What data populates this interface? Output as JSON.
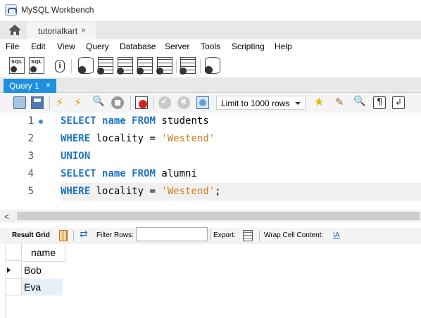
{
  "window": {
    "title": "MySQL Workbench"
  },
  "connection_tab": {
    "label": "tutorialkart",
    "close": "×"
  },
  "menu": [
    "File",
    "Edit",
    "View",
    "Query",
    "Database",
    "Server",
    "Tools",
    "Scripting",
    "Help"
  ],
  "query_tab": {
    "label": "Query 1",
    "close": "×"
  },
  "sql_toolbar": {
    "limit_value": "Limit to 1000 rows"
  },
  "editor": {
    "line_numbers": [
      "1",
      "2",
      "3",
      "4",
      "5"
    ],
    "lines": [
      [
        {
          "t": "SELECT",
          "k": "kw"
        },
        {
          "t": " "
        },
        {
          "t": "name",
          "k": "kw"
        },
        {
          "t": " "
        },
        {
          "t": "FROM",
          "k": "kw"
        },
        {
          "t": " students"
        }
      ],
      [
        {
          "t": "WHERE",
          "k": "kw"
        },
        {
          "t": " locality = "
        },
        {
          "t": "'Westend'",
          "k": "str"
        }
      ],
      [
        {
          "t": "UNION",
          "k": "kw"
        }
      ],
      [
        {
          "t": "SELECT",
          "k": "kw"
        },
        {
          "t": " "
        },
        {
          "t": "name",
          "k": "kw"
        },
        {
          "t": " "
        },
        {
          "t": "FROM",
          "k": "kw"
        },
        {
          "t": " alumni"
        }
      ],
      [
        {
          "t": "WHERE",
          "k": "kw"
        },
        {
          "t": " locality = "
        },
        {
          "t": "'Westend'",
          "k": "str"
        },
        {
          "t": ";"
        }
      ]
    ],
    "current_line": 5
  },
  "scrollbar": {
    "left_arrow": "<"
  },
  "result_toolbar": {
    "result_grid_label": "Result Grid",
    "filter_label": "Filter Rows:",
    "filter_value": "",
    "export_label": "Export:",
    "wrap_label": "Wrap Cell Content:",
    "wrap_icon_text": "IA"
  },
  "result": {
    "columns": [
      "name"
    ],
    "rows": [
      [
        "Bob"
      ],
      [
        "Eva"
      ]
    ],
    "selected_row": 1
  },
  "colors": {
    "keyword": "#1d74c4",
    "string": "#d07a18",
    "query_tab": "#1e8fe1"
  }
}
